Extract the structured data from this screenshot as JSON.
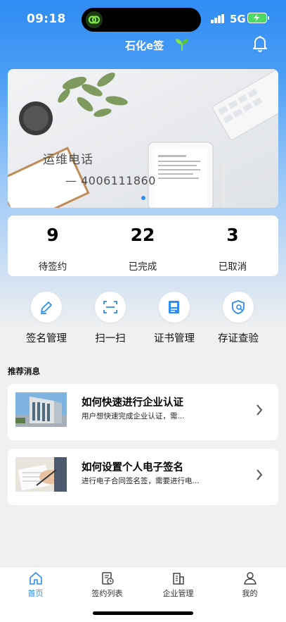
{
  "status_bar": {
    "time": "09:18",
    "network": "5G"
  },
  "header": {
    "title": "石化e签",
    "leaf_icon": "leaf-icon",
    "bell_icon": "bell-icon"
  },
  "banner": {
    "line1": "运维电话",
    "line2": "— 4006111860"
  },
  "stats": [
    {
      "value": "9",
      "label": "待签约"
    },
    {
      "value": "22",
      "label": "已完成"
    },
    {
      "value": "3",
      "label": "已取消"
    }
  ],
  "actions": [
    {
      "label": "签名管理",
      "icon": "pen-icon"
    },
    {
      "label": "扫一扫",
      "icon": "scan-icon"
    },
    {
      "label": "证书管理",
      "icon": "certificate-icon"
    },
    {
      "label": "存证查验",
      "icon": "shield-search-icon"
    }
  ],
  "news_section_title": "推荐消息",
  "news": [
    {
      "title": "如何快速进行企业认证",
      "desc": "用户想快速完成企业认证，需..."
    },
    {
      "title": "如何设置个人电子签名",
      "desc": "进行电子合同签名签，需要进行电..."
    }
  ],
  "tabs": [
    {
      "label": "首页",
      "icon": "home-icon",
      "active": true
    },
    {
      "label": "签约列表",
      "icon": "contract-list-icon",
      "active": false
    },
    {
      "label": "企业管理",
      "icon": "building-icon",
      "active": false
    },
    {
      "label": "我的",
      "icon": "user-icon",
      "active": false
    }
  ],
  "colors": {
    "accent": "#2f8cf3",
    "battery": "#4cd964"
  }
}
